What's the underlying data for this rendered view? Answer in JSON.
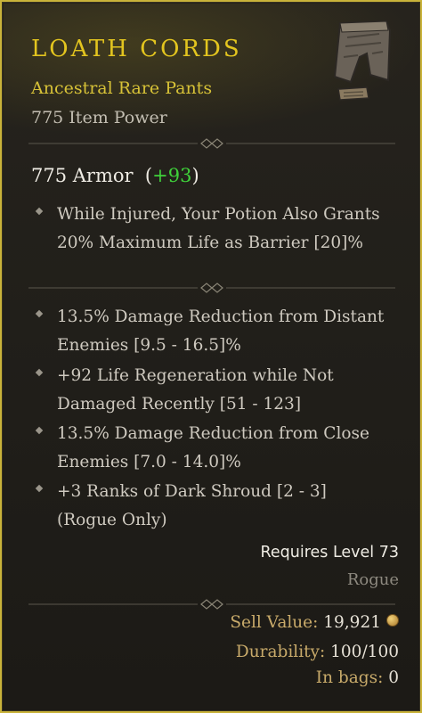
{
  "item": {
    "name": "LOATH CORDS",
    "type": "Ancestral Rare Pants",
    "item_power": "775 Item Power",
    "icon": "pants-icon"
  },
  "armor": {
    "value": "775 Armor",
    "delta": "+93"
  },
  "implicit_affixes": [
    "While Injured, Your Potion Also Grants 20% Maximum Life as Barrier [20]%"
  ],
  "affixes": [
    "13.5% Damage Reduction from Distant Enemies [9.5 - 16.5]%",
    "+92 Life Regeneration while Not Damaged Recently [51 - 123]",
    "13.5% Damage Reduction from Close Enemies [7.0 - 14.0]%",
    "+3 Ranks of Dark Shroud [2 - 3] (Rogue Only)"
  ],
  "requirements": {
    "level": "Requires Level 73",
    "class": "Rogue"
  },
  "footer": {
    "sell_label": "Sell Value:",
    "sell_value": "19,921",
    "durability_label": "Durability:",
    "durability_value": "100/100",
    "bags_label": "In bags:",
    "bags_value": "0"
  },
  "colors": {
    "border": "#c9b33a",
    "name": "#e3c51f",
    "type": "#d7c237",
    "positive": "#3fd23a",
    "footer_label": "#c8aa6a"
  }
}
